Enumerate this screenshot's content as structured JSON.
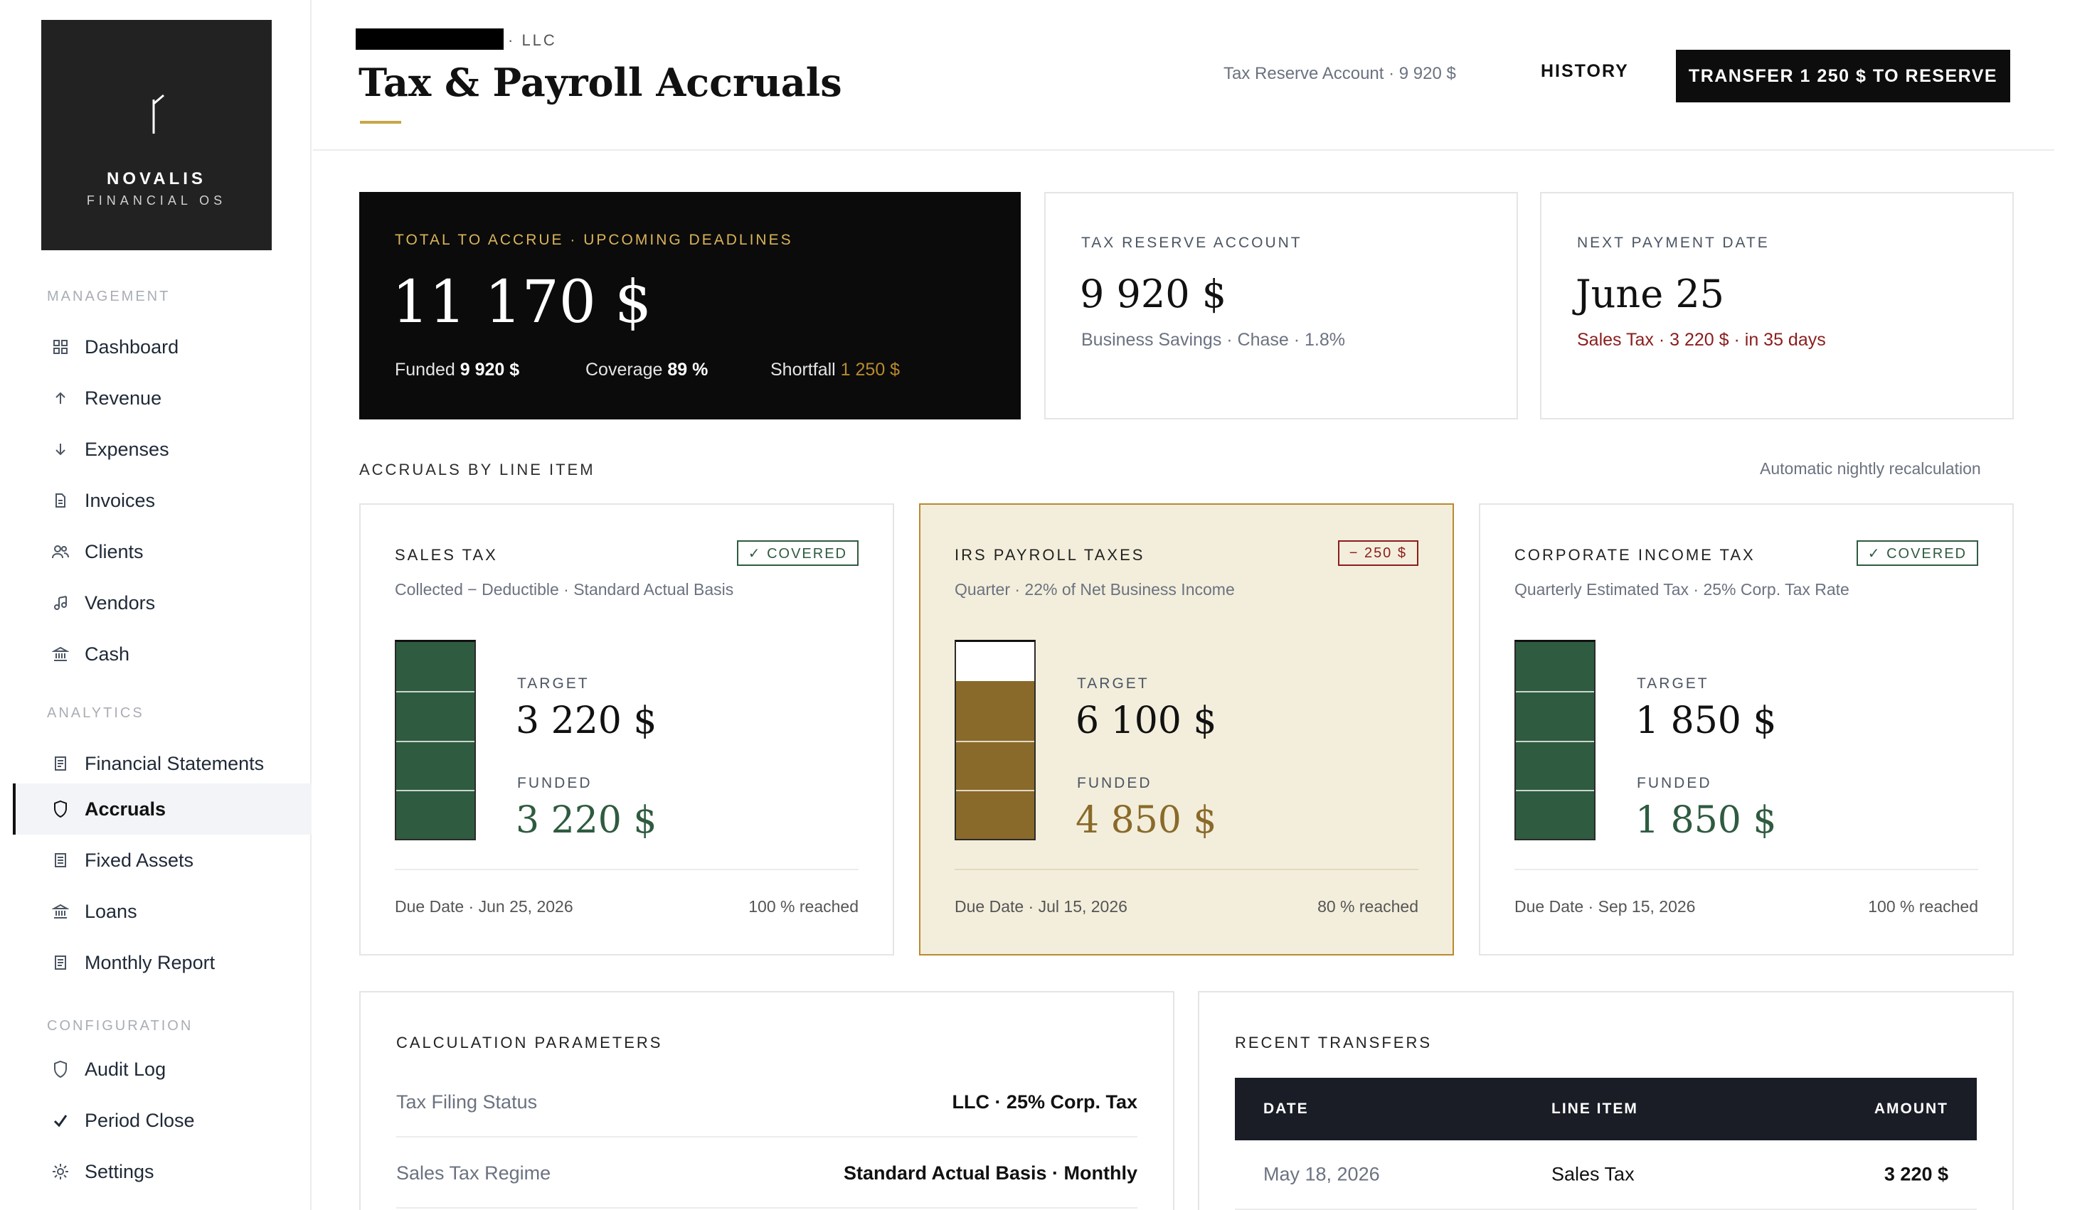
{
  "brand": {
    "name": "NOVALIS",
    "subtitle": "FINANCIAL OS"
  },
  "sidebar": {
    "sections": [
      {
        "title": "MANAGEMENT",
        "items": [
          {
            "label": "Dashboard",
            "icon": "grid-icon"
          },
          {
            "label": "Revenue",
            "icon": "arrow-up-icon"
          },
          {
            "label": "Expenses",
            "icon": "arrow-down-icon"
          },
          {
            "label": "Invoices",
            "icon": "document-icon"
          },
          {
            "label": "Clients",
            "icon": "users-icon"
          },
          {
            "label": "Vendors",
            "icon": "vendor-icon"
          },
          {
            "label": "Cash",
            "icon": "bank-icon"
          }
        ]
      },
      {
        "title": "ANALYTICS",
        "items": [
          {
            "label": "Financial Statements",
            "icon": "statement-icon"
          },
          {
            "label": "Accruals",
            "icon": "shield-icon",
            "active": true
          },
          {
            "label": "Fixed Assets",
            "icon": "ledger-icon"
          },
          {
            "label": "Loans",
            "icon": "bank-icon"
          },
          {
            "label": "Monthly Report",
            "icon": "report-icon"
          }
        ]
      },
      {
        "title": "CONFIGURATION",
        "items": [
          {
            "label": "Audit Log",
            "icon": "shield-icon"
          },
          {
            "label": "Period Close",
            "icon": "check-icon"
          },
          {
            "label": "Settings",
            "icon": "gear-icon"
          }
        ]
      }
    ]
  },
  "header": {
    "entity_suffix": "· LLC",
    "title": "Tax & Payroll Accruals",
    "reserve_chip": "Tax Reserve Account · 9 920 $",
    "history_label": "HISTORY",
    "transfer_label": "TRANSFER 1 250 $ TO RESERVE"
  },
  "summary": {
    "total": {
      "label": "TOTAL TO ACCRUE · UPCOMING DEADLINES",
      "amount": "11 170 $",
      "funded_label": "Funded",
      "funded_value": "9 920 $",
      "coverage_label": "Coverage",
      "coverage_value": "89 %",
      "shortfall_label": "Shortfall",
      "shortfall_value": "1 250 $"
    },
    "reserve": {
      "label": "TAX RESERVE ACCOUNT",
      "amount": "9 920 $",
      "sub": "Business Savings · Chase · 1.8%"
    },
    "next_payment": {
      "label": "NEXT PAYMENT DATE",
      "date": "June 25",
      "sub": "Sales Tax · 3 220 $ · in 35 days"
    }
  },
  "accruals": {
    "section_title": "ACCRUALS BY LINE ITEM",
    "note": "Automatic nightly recalculation",
    "target_label": "TARGET",
    "funded_label": "FUNDED",
    "items": [
      {
        "title": "SALES TAX",
        "badge": "✓ COVERED",
        "badge_status": "ok",
        "desc": "Collected − Deductible · Standard Actual Basis",
        "target": "3 220 $",
        "funded": "3 220 $",
        "fill_fraction": 1.0,
        "due": "Due Date · Jun 25, 2026",
        "reached": "100 % reached"
      },
      {
        "title": "IRS PAYROLL TAXES",
        "badge": "− 250 $",
        "badge_status": "bad",
        "desc": "Quarter · 22% of Net Business Income",
        "target": "6 100 $",
        "funded": "4 850 $",
        "fill_fraction": 0.8,
        "due": "Due Date · Jul 15, 2026",
        "reached": "80 % reached"
      },
      {
        "title": "CORPORATE INCOME TAX",
        "badge": "✓ COVERED",
        "badge_status": "ok",
        "desc": "Quarterly Estimated Tax · 25% Corp. Tax Rate",
        "target": "1 850 $",
        "funded": "1 850 $",
        "fill_fraction": 1.0,
        "due": "Due Date · Sep 15, 2026",
        "reached": "100 % reached"
      }
    ]
  },
  "parameters": {
    "title": "CALCULATION PARAMETERS",
    "rows": [
      {
        "label": "Tax Filing Status",
        "value": "LLC · 25% Corp. Tax"
      },
      {
        "label": "Sales Tax Regime",
        "value": "Standard Actual Basis · Monthly"
      }
    ]
  },
  "transfers": {
    "title": "RECENT TRANSFERS",
    "columns": [
      "DATE",
      "LINE ITEM",
      "AMOUNT"
    ],
    "rows": [
      {
        "date": "May 18, 2026",
        "item": "Sales Tax",
        "amount": "3 220 $"
      }
    ]
  },
  "colors": {
    "covered": "#2f5b40",
    "shortfall": "#8b1d1d",
    "warn_fill": "#8a6a2a",
    "accent_gold": "#c9a548"
  }
}
